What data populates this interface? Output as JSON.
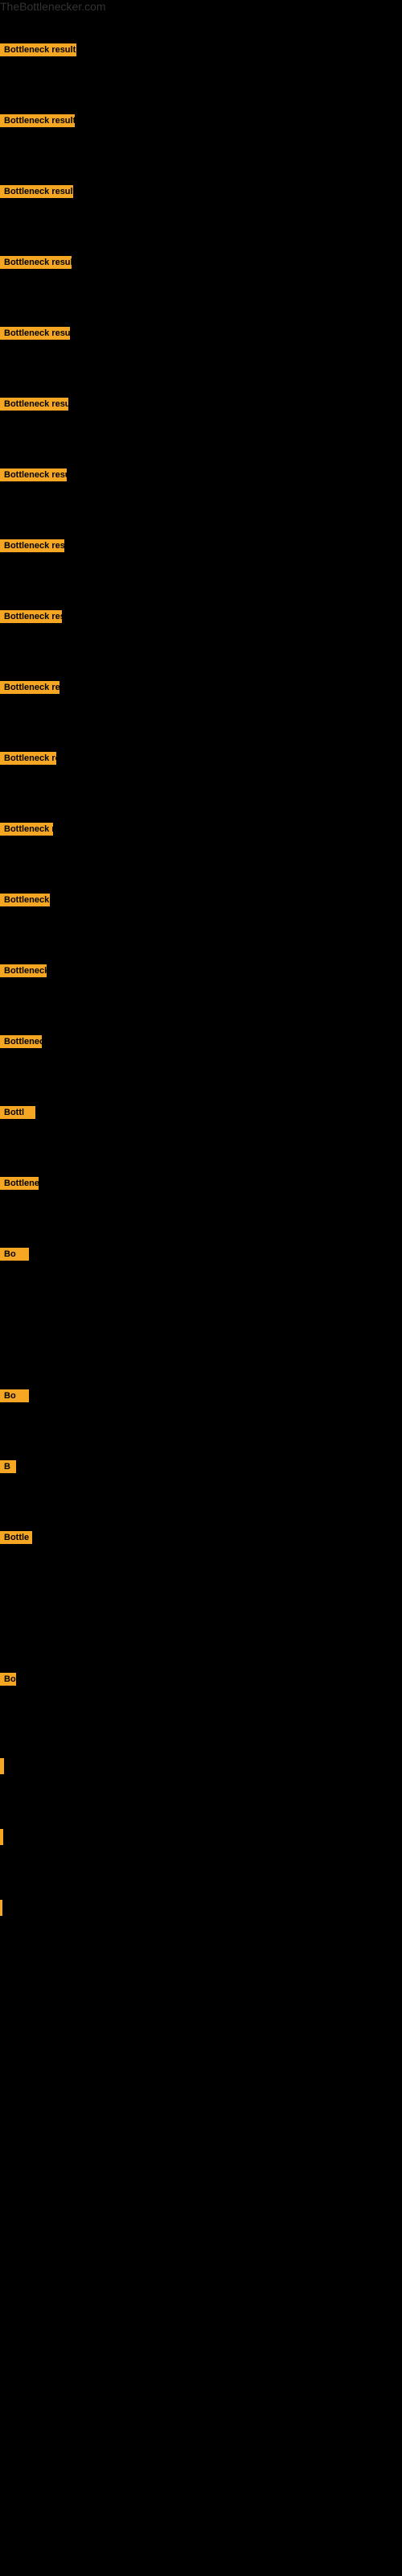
{
  "site": {
    "title": "TheBottlenecker.com"
  },
  "rows": [
    {
      "id": 1,
      "label": "Bottleneck result",
      "visible": true
    },
    {
      "id": 2,
      "label": "Bottleneck result",
      "visible": true
    },
    {
      "id": 3,
      "label": "Bottleneck result",
      "visible": true
    },
    {
      "id": 4,
      "label": "Bottleneck result",
      "visible": true
    },
    {
      "id": 5,
      "label": "Bottleneck result",
      "visible": true
    },
    {
      "id": 6,
      "label": "Bottleneck result",
      "visible": true
    },
    {
      "id": 7,
      "label": "Bottleneck result",
      "visible": true
    },
    {
      "id": 8,
      "label": "Bottleneck result",
      "visible": true
    },
    {
      "id": 9,
      "label": "Bottleneck result",
      "visible": true
    },
    {
      "id": 10,
      "label": "Bottleneck result",
      "visible": true
    },
    {
      "id": 11,
      "label": "Bottleneck resu",
      "visible": true
    },
    {
      "id": 12,
      "label": "Bottleneck res",
      "visible": true
    },
    {
      "id": 13,
      "label": "Bottleneck res",
      "visible": true
    },
    {
      "id": 14,
      "label": "Bottleneck re",
      "visible": true
    },
    {
      "id": 15,
      "label": "Bottleneck",
      "visible": true
    },
    {
      "id": 16,
      "label": "Bottl",
      "visible": true
    },
    {
      "id": 17,
      "label": "Bottlene",
      "visible": true
    },
    {
      "id": 18,
      "label": "Bo",
      "visible": true
    },
    {
      "id": 19,
      "label": "",
      "visible": false
    },
    {
      "id": 20,
      "label": "Bo",
      "visible": true
    },
    {
      "id": 21,
      "label": "B",
      "visible": true
    },
    {
      "id": 22,
      "label": "Bottle",
      "visible": true
    },
    {
      "id": 23,
      "label": "",
      "visible": false
    },
    {
      "id": 24,
      "label": "Bo",
      "visible": true
    }
  ],
  "bottom_bars": [
    {
      "id": 1,
      "class": "bar-1"
    },
    {
      "id": 2,
      "class": "bar-2"
    },
    {
      "id": 3,
      "class": "bar-3"
    }
  ],
  "colors": {
    "background": "#000000",
    "label_bg": "#f5a623",
    "label_text": "#000000",
    "title_text": "#333333"
  }
}
